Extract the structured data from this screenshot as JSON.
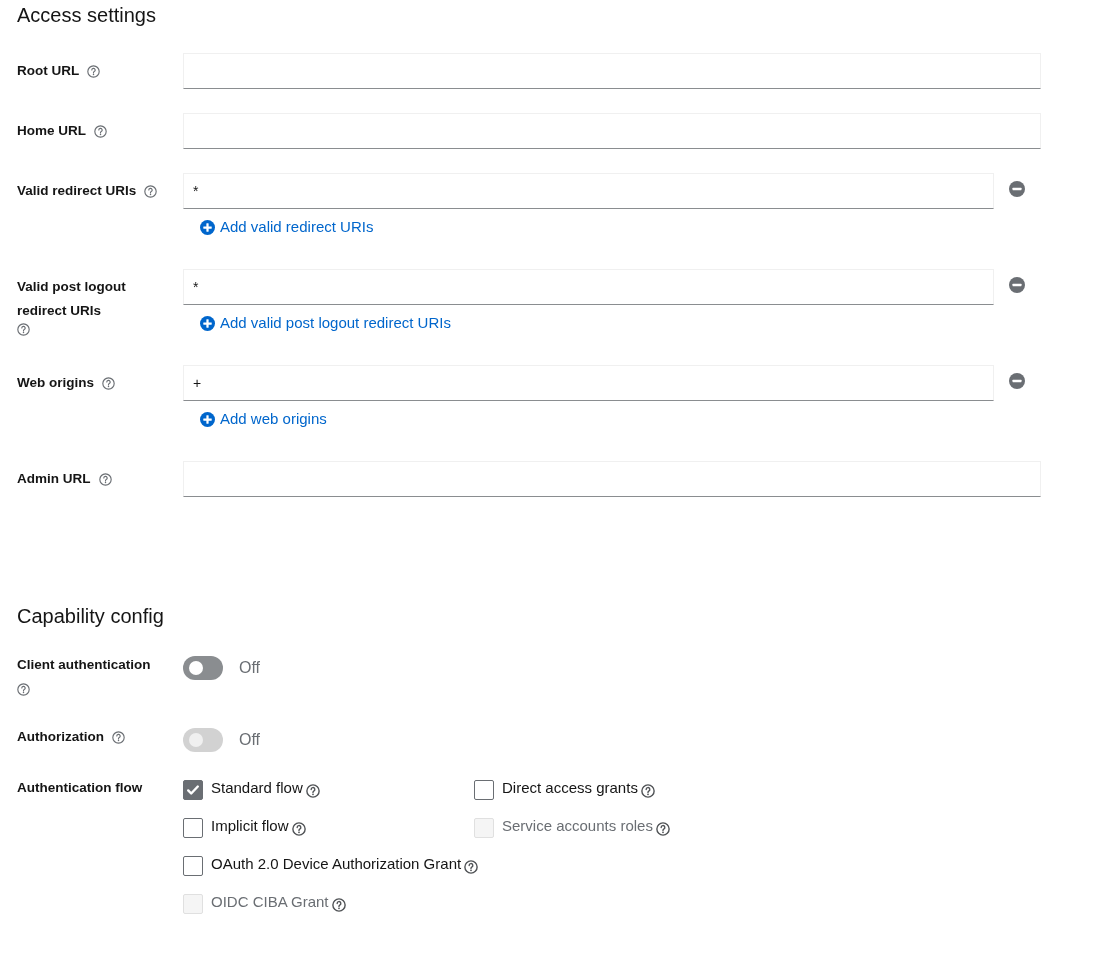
{
  "access_settings": {
    "title": "Access settings",
    "fields": [
      {
        "kind": "single",
        "label": "Root URL"
      },
      {
        "kind": "single",
        "label": "Home URL"
      },
      {
        "kind": "multi",
        "label": "Valid redirect URIs",
        "value": "*",
        "add_label": "Add valid redirect URIs"
      },
      {
        "kind": "multi",
        "label": "Valid post logout redirect URIs",
        "value": "*",
        "add_label": "Add valid post logout redirect URIs"
      },
      {
        "kind": "multi",
        "label": "Web origins",
        "value": "+",
        "add_label": "Add web origins"
      },
      {
        "kind": "single",
        "label": "Admin URL"
      }
    ]
  },
  "capability_config": {
    "title": "Capability config",
    "rows": [
      {
        "kind": "toggle",
        "label": "Client authentication",
        "on": false,
        "disabled": false,
        "state_text": "Off"
      },
      {
        "kind": "toggle",
        "label": "Authorization",
        "on": false,
        "disabled": true,
        "state_text": "Off"
      },
      {
        "kind": "checkboxes",
        "label": "Authentication flow",
        "option_rows": [
          [
            {
              "label": "Standard flow",
              "checked": true,
              "disabled": false
            },
            {
              "label": "Direct access grants",
              "checked": false,
              "disabled": false
            }
          ],
          [
            {
              "label": "Implicit flow",
              "checked": false,
              "disabled": false
            },
            {
              "label": "Service accounts roles",
              "checked": false,
              "disabled": true
            }
          ],
          [
            {
              "label": "OAuth 2.0 Device Authorization Grant",
              "checked": false,
              "disabled": false
            }
          ],
          [
            {
              "label": "OIDC CIBA Grant",
              "checked": false,
              "disabled": true
            }
          ]
        ]
      }
    ]
  }
}
